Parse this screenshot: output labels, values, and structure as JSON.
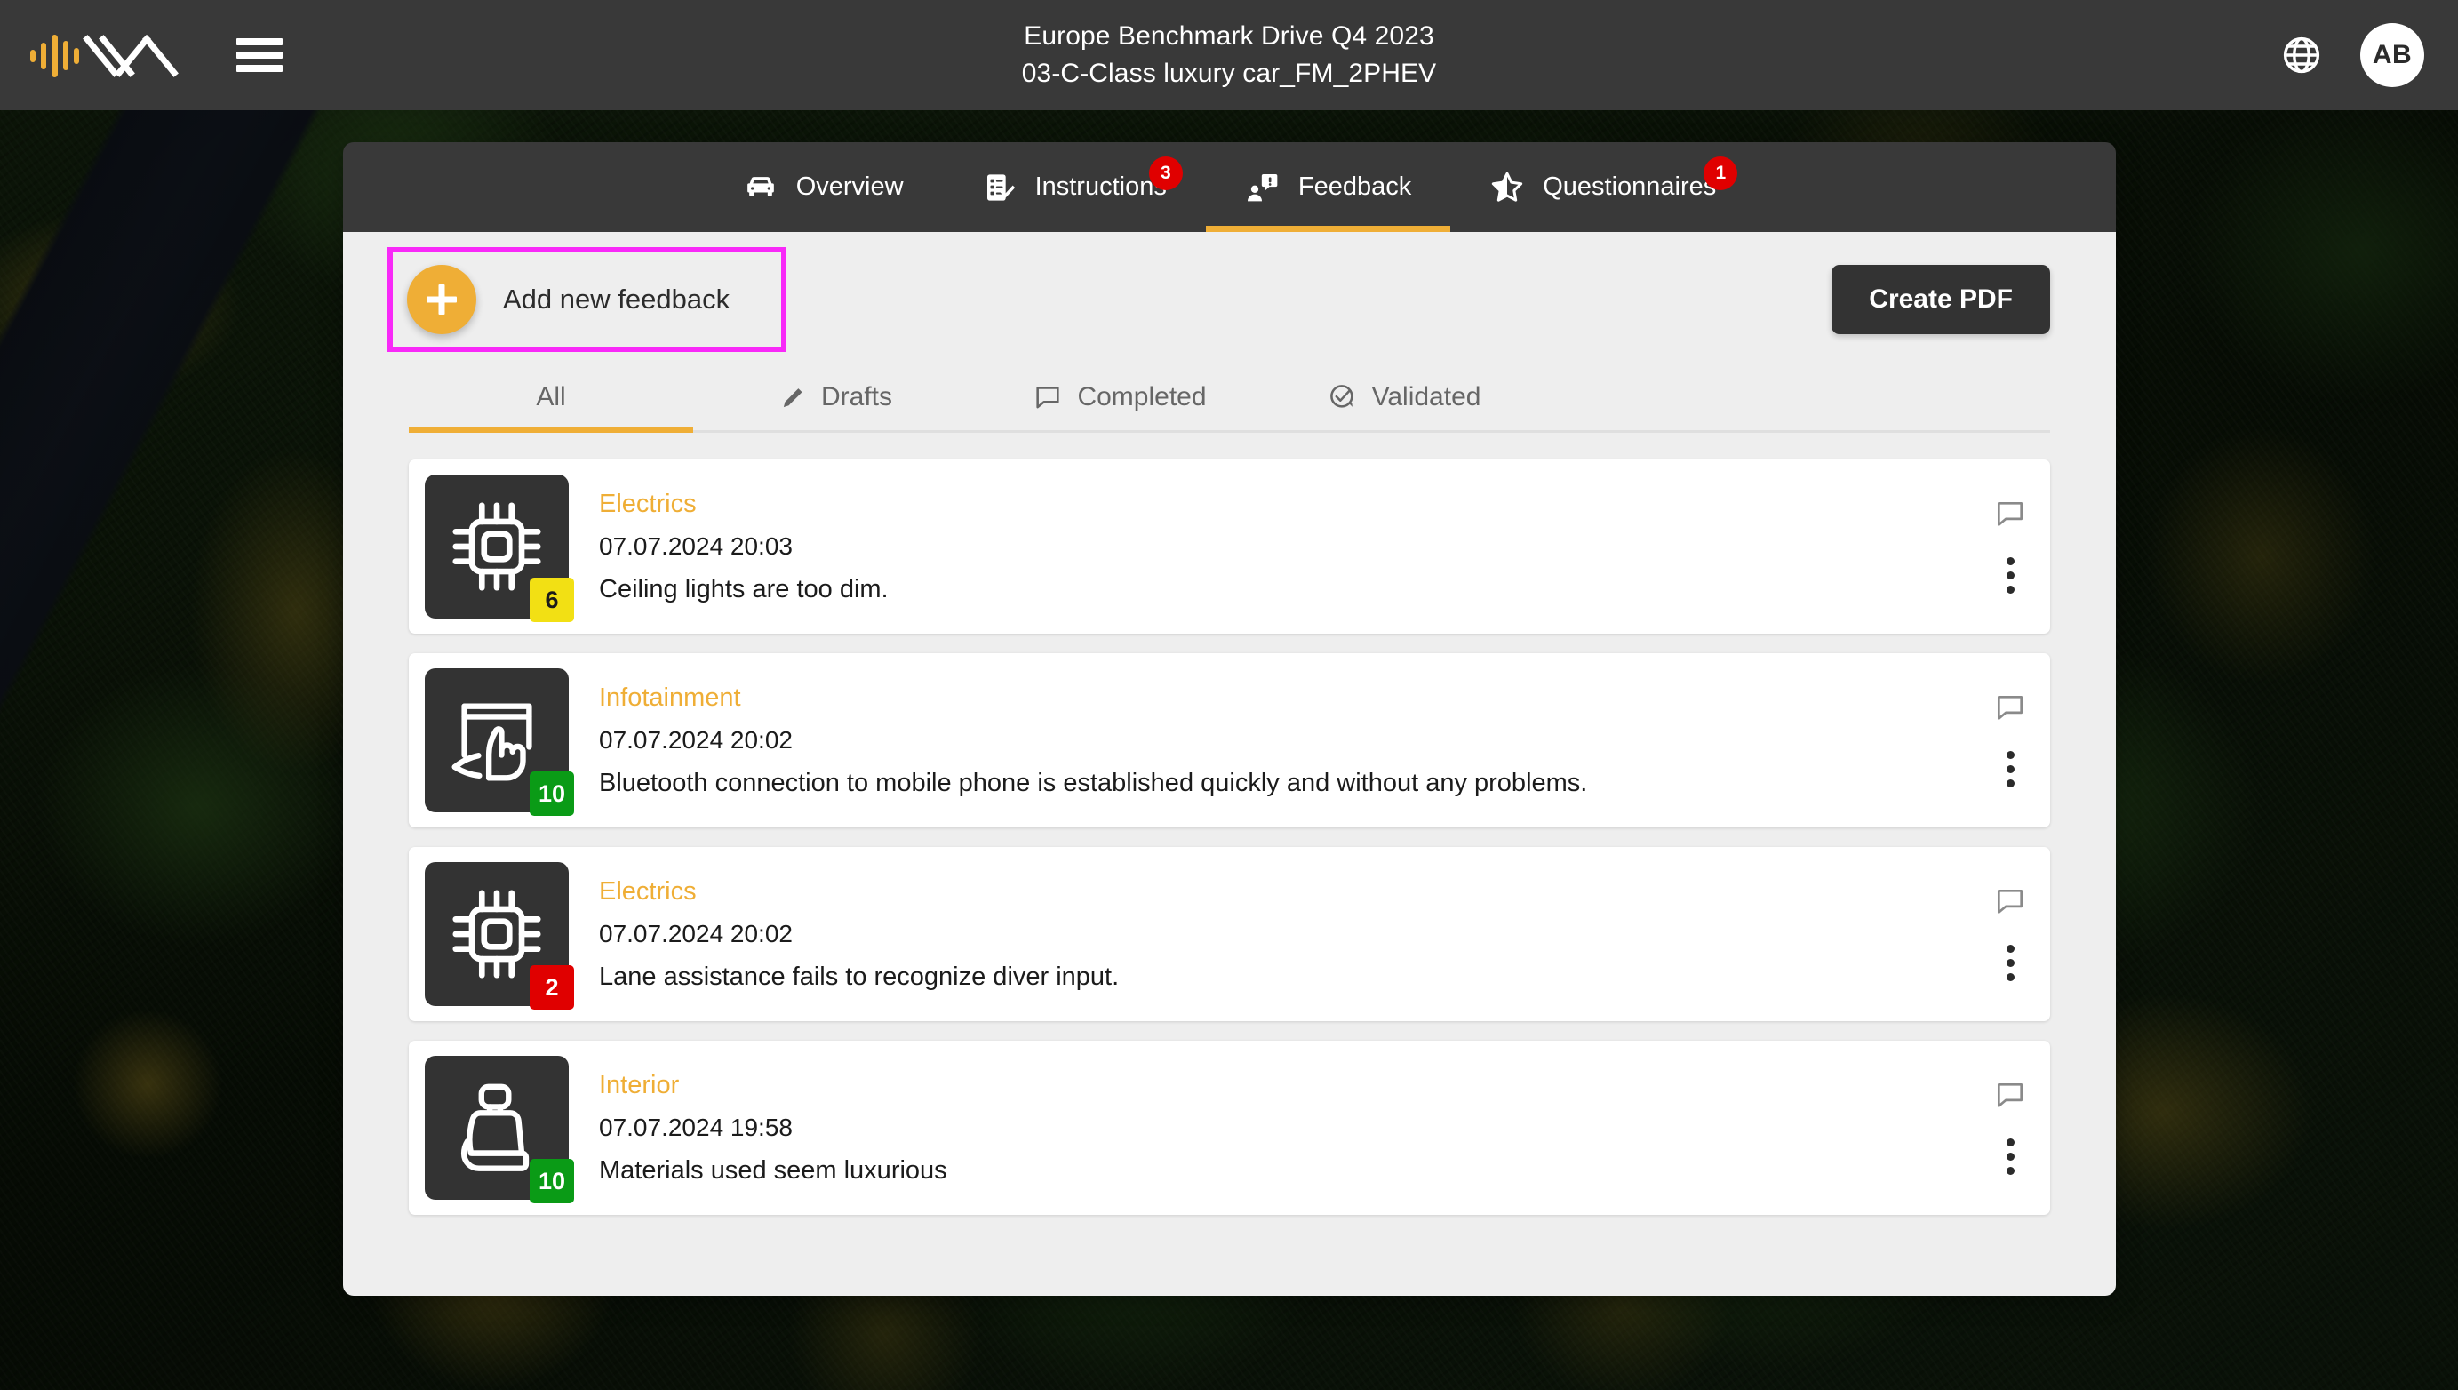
{
  "topbar": {
    "logo_name": "vehicle-analytics-logo",
    "menu_label": "Menu",
    "title_line1": "Europe Benchmark Drive Q4 2023",
    "title_line2": "03-C-Class luxury car_FM_2PHEV",
    "language_icon": "globe-icon",
    "avatar_initials": "AB"
  },
  "nav": {
    "tabs": [
      {
        "label": "Overview",
        "icon": "car-front-icon",
        "badge": "",
        "active": false
      },
      {
        "label": "Instructions",
        "icon": "checklist-icon",
        "badge": "3",
        "active": false
      },
      {
        "label": "Feedback",
        "icon": "person-speech-bubble-icon",
        "badge": "",
        "active": true
      },
      {
        "label": "Questionnaires",
        "icon": "star-half-icon",
        "badge": "1",
        "active": false
      }
    ],
    "active_indicator_color": "#efae36",
    "badge_color": "#e00000"
  },
  "actions": {
    "add_feedback_label": "Add new feedback",
    "add_feedback_icon": "plus-icon",
    "add_feedback_highlight_color": "#f829f8",
    "create_pdf_label": "Create PDF"
  },
  "filters": {
    "tabs": [
      {
        "label": "All",
        "icon": "",
        "active": true
      },
      {
        "label": "Drafts",
        "icon": "pencil-icon",
        "active": false
      },
      {
        "label": "Completed",
        "icon": "comment-icon",
        "active": false
      },
      {
        "label": "Validated",
        "icon": "check-circle-icon",
        "active": false
      }
    ]
  },
  "feedback": {
    "items": [
      {
        "category": "Electrics",
        "date": "07.07.2024 20:03",
        "text": "Ceiling lights are too dim.",
        "score": "6",
        "score_color": "#f2e014",
        "score_text_color": "#1b1b1b",
        "icon": "microchip-icon",
        "comment_icon": "comment-icon",
        "menu_icon": "kebab-menu-icon"
      },
      {
        "category": "Infotainment",
        "date": "07.07.2024 20:02",
        "text": "Bluetooth connection to mobile phone is established quickly and without any problems.",
        "score": "10",
        "score_color": "#0a9b16",
        "score_text_color": "#ffffff",
        "icon": "touchscreen-hand-icon",
        "comment_icon": "comment-icon",
        "menu_icon": "kebab-menu-icon"
      },
      {
        "category": "Electrics",
        "date": "07.07.2024 20:02",
        "text": "Lane assistance fails to recognize diver input.",
        "score": "2",
        "score_color": "#e00000",
        "score_text_color": "#ffffff",
        "icon": "microchip-icon",
        "comment_icon": "comment-icon",
        "menu_icon": "kebab-menu-icon"
      },
      {
        "category": "Interior",
        "date": "07.07.2024 19:58",
        "text": "Materials used seem luxurious",
        "score": "10",
        "score_color": "#0a9b16",
        "score_text_color": "#ffffff",
        "icon": "car-seat-icon",
        "comment_icon": "comment-icon",
        "menu_icon": "kebab-menu-icon"
      }
    ]
  },
  "colors": {
    "accent": "#efae36",
    "dark": "#393939",
    "panel_bg": "#eeeeee",
    "card_bg": "#ffffff"
  }
}
